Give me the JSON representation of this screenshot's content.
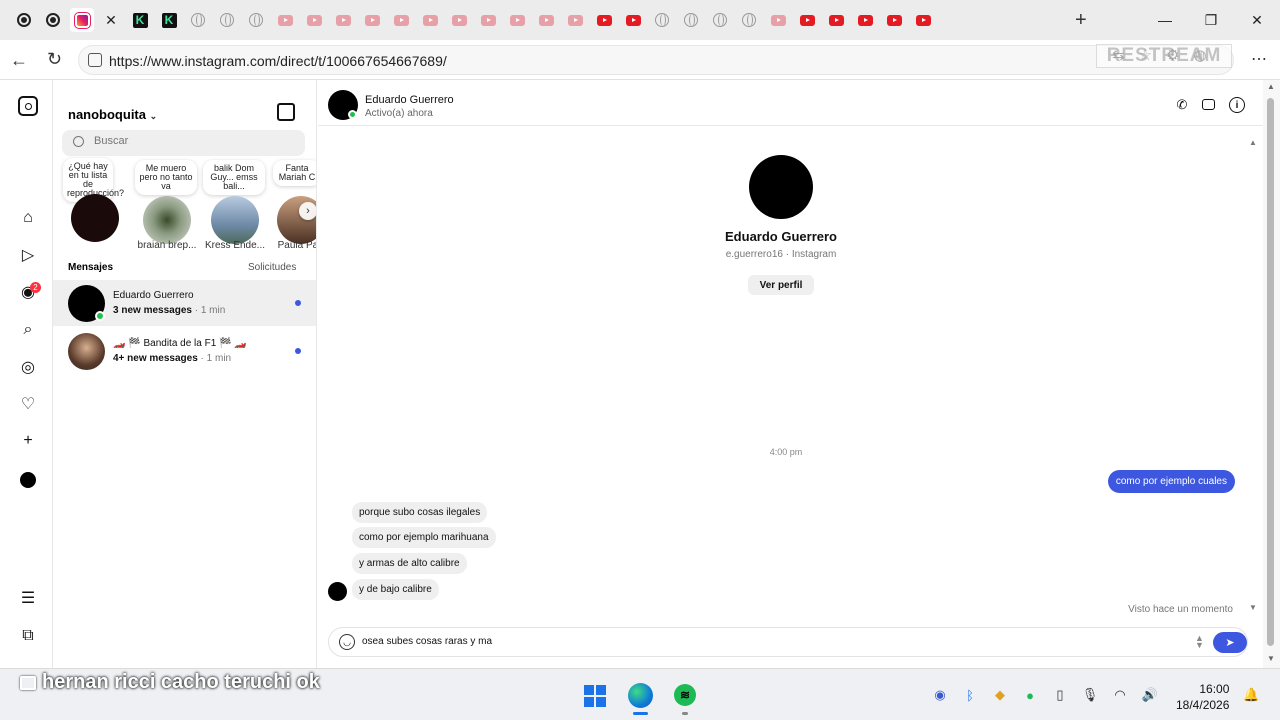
{
  "browser": {
    "tabs": [
      {
        "icon": "circle-dot-icon"
      },
      {
        "icon": "circle-dot-icon"
      },
      {
        "icon": "instagram-icon",
        "active": true
      },
      {
        "icon": "close-icon",
        "glyph": "✕"
      },
      {
        "icon": "kick-icon",
        "glyph": "K"
      },
      {
        "icon": "kick-icon",
        "glyph": "K"
      },
      {
        "icon": "globe-icon"
      },
      {
        "icon": "globe-icon"
      },
      {
        "icon": "globe-icon"
      },
      {
        "icon": "youtube-icon"
      },
      {
        "icon": "youtube-icon"
      },
      {
        "icon": "youtube-icon"
      },
      {
        "icon": "youtube-icon"
      },
      {
        "icon": "youtube-icon"
      },
      {
        "icon": "youtube-icon"
      },
      {
        "icon": "youtube-icon"
      },
      {
        "icon": "youtube-icon"
      },
      {
        "icon": "youtube-icon"
      },
      {
        "icon": "youtube-icon"
      },
      {
        "icon": "youtube-icon"
      },
      {
        "icon": "youtube-red-icon"
      },
      {
        "icon": "youtube-red-icon"
      },
      {
        "icon": "globe-icon"
      },
      {
        "icon": "globe-icon"
      },
      {
        "icon": "globe-icon"
      },
      {
        "icon": "globe-icon"
      },
      {
        "icon": "youtube-icon"
      },
      {
        "icon": "youtube-red-icon"
      },
      {
        "icon": "youtube-red-icon"
      },
      {
        "icon": "youtube-red-icon"
      },
      {
        "icon": "youtube-red-icon"
      },
      {
        "icon": "youtube-red-icon"
      }
    ],
    "new_tab": "+",
    "window_controls": {
      "minimize": "—",
      "restore": "❐",
      "close": "✕"
    },
    "url": "https://www.instagram.com/direct/t/100667654667689/",
    "watermark": "RESTREAM"
  },
  "instagram": {
    "username": "nanoboquita",
    "search_placeholder": "Buscar",
    "notes": [
      {
        "text": "¿Qué hay en tu lista de reproducción?",
        "name": ""
      },
      {
        "text": "Me muero pero no tanto va",
        "name": "braian brep..."
      },
      {
        "text": "balik Dom Guy... emss bali...",
        "name": "Kress Ende..."
      },
      {
        "text": "Fanta Mariah C",
        "name": "Paula Pal"
      }
    ],
    "messages_label": "Mensajes",
    "requests_label": "Solicitudes",
    "threads": [
      {
        "name": "Eduardo Guerrero",
        "unread": "3 new messages",
        "time": " · 1 min",
        "online": true
      },
      {
        "name": "🏎️ 🏁 Bandita de la F1 🏁 🏎️",
        "unread": "4+ new messages",
        "time": " · 1 min",
        "online": false
      }
    ]
  },
  "chat": {
    "contact_name": "Eduardo Guerrero",
    "contact_status": "Activo(a) ahora",
    "profile_name": "Eduardo Guerrero",
    "profile_sub": "e.guerrero16 · Instagram",
    "view_profile": "Ver perfil",
    "timestamp": "4:00 pm",
    "sent_message": "como por ejemplo cuales",
    "received_messages": [
      "porque subo cosas ilegales",
      "como por ejemplo marihuana",
      "y armas de alto calibre",
      "y de bajo calibre"
    ],
    "seen": "Visto hace un momento",
    "draft": "osea subes cosas raras y ma"
  },
  "overlay": {
    "caption": "hernan ricci cacho teruchi ok"
  },
  "taskbar": {
    "time": "16:00",
    "date": "18/4/2026",
    "badge_count": "2"
  },
  "colors": {
    "accent": "#3d57e0",
    "online": "#1ec14b",
    "notification": "#ff3040"
  }
}
